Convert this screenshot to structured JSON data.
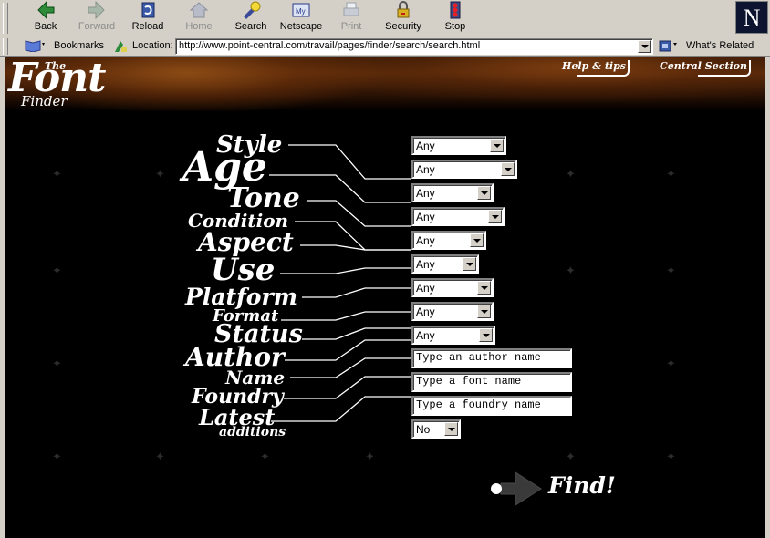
{
  "browser": {
    "toolbar": {
      "back": "Back",
      "forward": "Forward",
      "reload": "Reload",
      "home": "Home",
      "search": "Search",
      "netscape": "Netscape",
      "print": "Print",
      "security": "Security",
      "stop": "Stop"
    },
    "logo_letter": "N",
    "bookmarks": "Bookmarks",
    "location_label": "Location:",
    "url": "http://www.point-central.com/travail/pages/finder/search/search.html",
    "whats_related": "What's Related"
  },
  "banner": {
    "logo_the": "The",
    "logo_font": "Font",
    "logo_finder": "Finder",
    "help": "Help & tips",
    "central": "Central Section"
  },
  "form": {
    "labels": {
      "style": "Style",
      "age": "Age",
      "tone": "Tone",
      "condition": "Condition",
      "aspect": "Aspect",
      "use": "Use",
      "platform": "Platform",
      "format": "Format",
      "status": "Status",
      "author": "Author",
      "name": "Name",
      "foundry": "Foundry",
      "latest": "Latest",
      "additions": "additions"
    },
    "style": "Any",
    "age": "Any",
    "tone": "Any",
    "condition": "Any",
    "aspect": "Any",
    "use": "Any",
    "platform": "Any",
    "format": "Any",
    "status": "Any",
    "author": "Type an author name",
    "name": "Type a font name",
    "foundry": "Type a foundry name",
    "latest": "No"
  },
  "find_label": "Find!"
}
